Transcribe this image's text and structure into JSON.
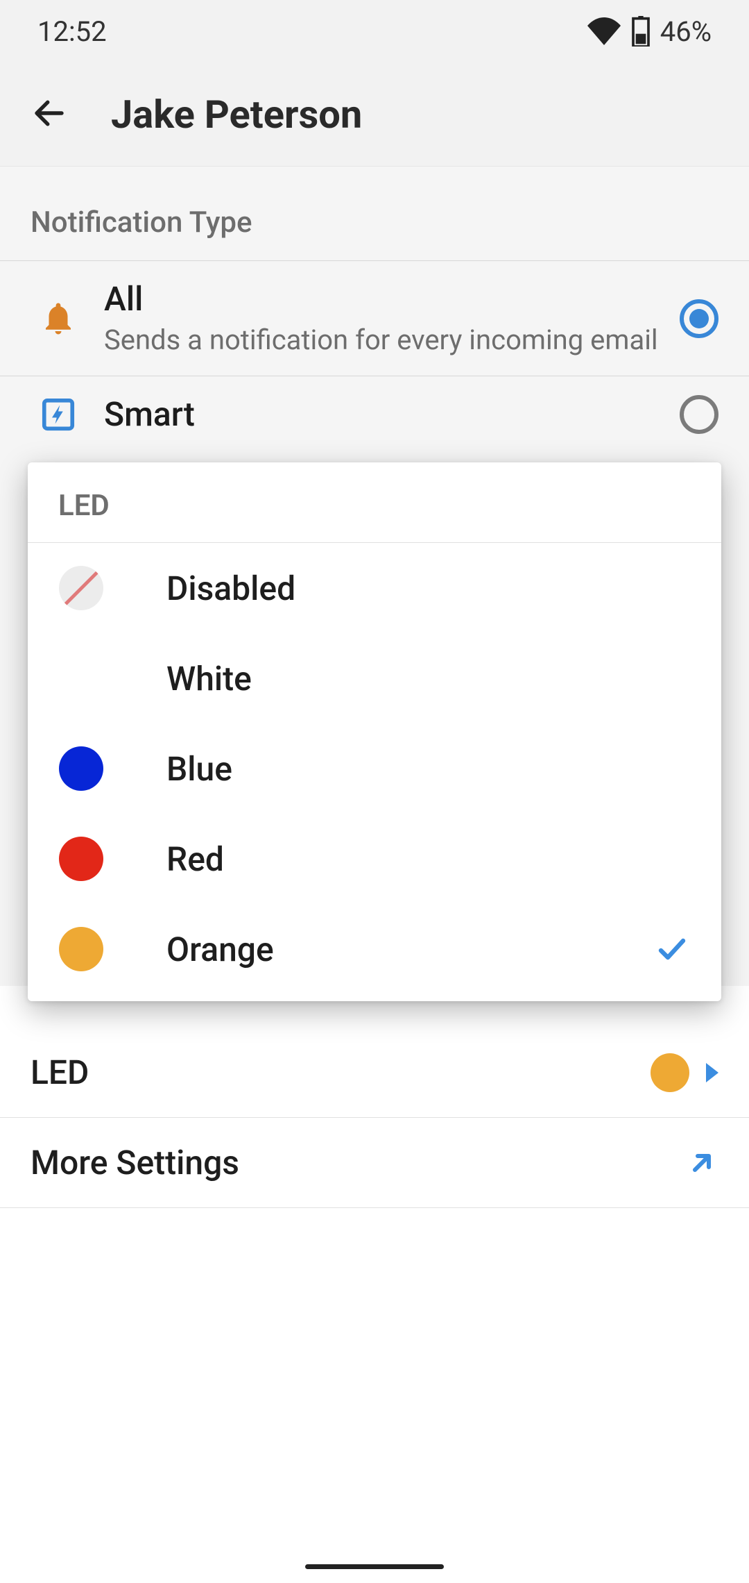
{
  "status_bar": {
    "time": "12:52",
    "battery_percent": "46%"
  },
  "header": {
    "title": "Jake Peterson"
  },
  "notification_section": {
    "heading": "Notification Type",
    "options": [
      {
        "title": "All",
        "subtitle": "Sends a notification for every incoming email",
        "selected": true
      },
      {
        "title": "Smart",
        "subtitle": "",
        "selected": false
      }
    ]
  },
  "led_row": {
    "label": "LED",
    "current_color": "#eea934"
  },
  "more_row": {
    "label": "More Settings"
  },
  "led_dialog": {
    "title": "LED",
    "items": [
      {
        "label": "Disabled",
        "color": null,
        "kind": "disabled",
        "selected": false
      },
      {
        "label": "White",
        "color": "#ffffff",
        "kind": "color",
        "selected": false
      },
      {
        "label": "Blue",
        "color": "#0726d6",
        "kind": "color",
        "selected": false
      },
      {
        "label": "Red",
        "color": "#e22718",
        "kind": "color",
        "selected": false
      },
      {
        "label": "Orange",
        "color": "#eea934",
        "kind": "color",
        "selected": true
      }
    ]
  }
}
